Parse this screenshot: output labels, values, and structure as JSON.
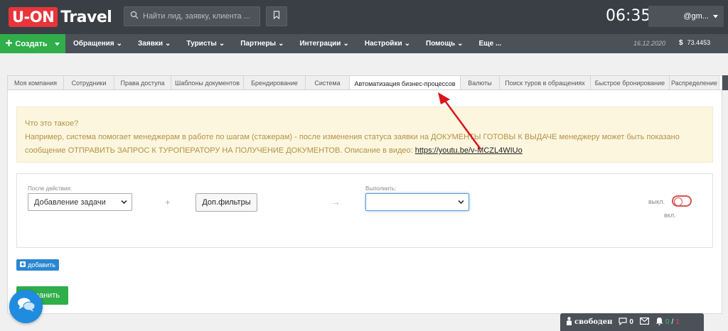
{
  "header": {
    "logo_badge": "U-ON",
    "logo_text": "Travel",
    "search_placeholder": "Найти лид, заявку, клиента ...",
    "clock": "06:35",
    "user_email": "@gm..."
  },
  "nav": {
    "create_label": "Создать",
    "items": [
      {
        "label": "Обращения"
      },
      {
        "label": "Заявки"
      },
      {
        "label": "Туристы"
      },
      {
        "label": "Партнеры"
      },
      {
        "label": "Интеграции"
      },
      {
        "label": "Настройки"
      },
      {
        "label": "Помощь"
      },
      {
        "label": "Еще ..."
      }
    ],
    "date": "16.12.2020",
    "currency": "$",
    "rate": "73.4453"
  },
  "tabs": [
    {
      "label": "Моя компания"
    },
    {
      "label": "Сотрудники"
    },
    {
      "label": "Права доступа"
    },
    {
      "label": "Шаблоны документов"
    },
    {
      "label": "Брендирование"
    },
    {
      "label": "Система"
    },
    {
      "label": "Автоматизация бизнес-процессов",
      "active": true
    },
    {
      "label": "Валюты"
    },
    {
      "label": "Поиск туров в обращениях"
    },
    {
      "label": "Быстрое бронирование"
    },
    {
      "label": "Распределение"
    }
  ],
  "info": {
    "title": "Что это такое?",
    "text": "Например, система помогает менеджерам в работе по шагам (стажерам) - после изменения статуса заявки на ДОКУМЕНТЫ ГОТОВЫ К ВЫДАЧЕ менеджеру может быть показано сообщение ОТПРАВИТЬ ЗАПРОС К ТУРОПЕРАТОРУ НА ПОЛУЧЕНИЕ ДОКУМЕНТОВ. Описание в видео: ",
    "link": "https://youtu.be/v-MCZL4WIUo"
  },
  "rule": {
    "after_label": "После действия:",
    "after_value": "Добавление задачи",
    "plus": "+",
    "filters_label": "Доп.фильтры",
    "arrow": "→",
    "execute_label": "Выполнить:",
    "execute_value": "",
    "off_label": "выкл.",
    "on_label": "вкл."
  },
  "actions": {
    "add_label": "добавить",
    "save_label": "ранить"
  },
  "status_bar": {
    "state": "свободен",
    "chats": "0",
    "notif_green": "0",
    "notif_sep": "/",
    "notif_red": "1"
  },
  "colors": {
    "topbar": "#3a3f45",
    "navbar": "#4b5159",
    "accent_green": "#2fae4a",
    "accent_blue": "#2a86d1",
    "logo_red": "#e8343a",
    "info_bg": "#fcf6df",
    "annotation_red": "#d9151b"
  }
}
